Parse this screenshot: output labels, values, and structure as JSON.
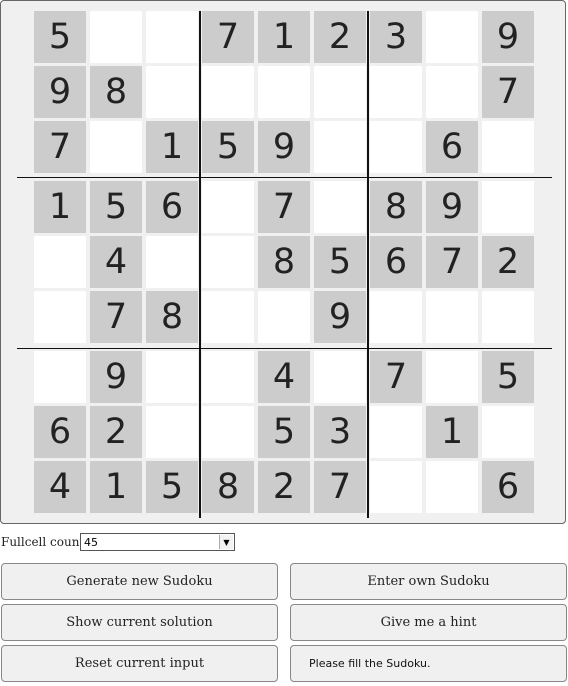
{
  "grid": [
    [
      "5",
      "",
      "",
      "7",
      "1",
      "2",
      "3",
      "",
      "9"
    ],
    [
      "9",
      "8",
      "",
      "",
      "",
      "",
      "",
      "",
      "7"
    ],
    [
      "7",
      "",
      "1",
      "5",
      "9",
      "",
      "",
      "6",
      ""
    ],
    [
      "1",
      "5",
      "6",
      "",
      "7",
      "",
      "8",
      "9",
      ""
    ],
    [
      "",
      "4",
      "",
      "",
      "8",
      "5",
      "6",
      "7",
      "2"
    ],
    [
      "",
      "7",
      "8",
      "",
      "",
      "9",
      "",
      "",
      ""
    ],
    [
      "",
      "9",
      "",
      "",
      "4",
      "",
      "7",
      "",
      "5"
    ],
    [
      "6",
      "2",
      "",
      "",
      "5",
      "3",
      "",
      "1",
      ""
    ],
    [
      "4",
      "1",
      "5",
      "8",
      "2",
      "7",
      "",
      "",
      "6"
    ]
  ],
  "controls": {
    "fullcell_label": "Fullcell count:",
    "fullcell_value": "45"
  },
  "buttons": {
    "generate": "Generate new Sudoku",
    "enter_own": "Enter own Sudoku",
    "show_solution": "Show current solution",
    "hint": "Give me a hint",
    "reset": "Reset current input"
  },
  "status": "Please fill the Sudoku.",
  "colors": {
    "given_cell": "#cccccc",
    "empty_cell": "#ffffff",
    "board_background": "#f0f0f0"
  }
}
